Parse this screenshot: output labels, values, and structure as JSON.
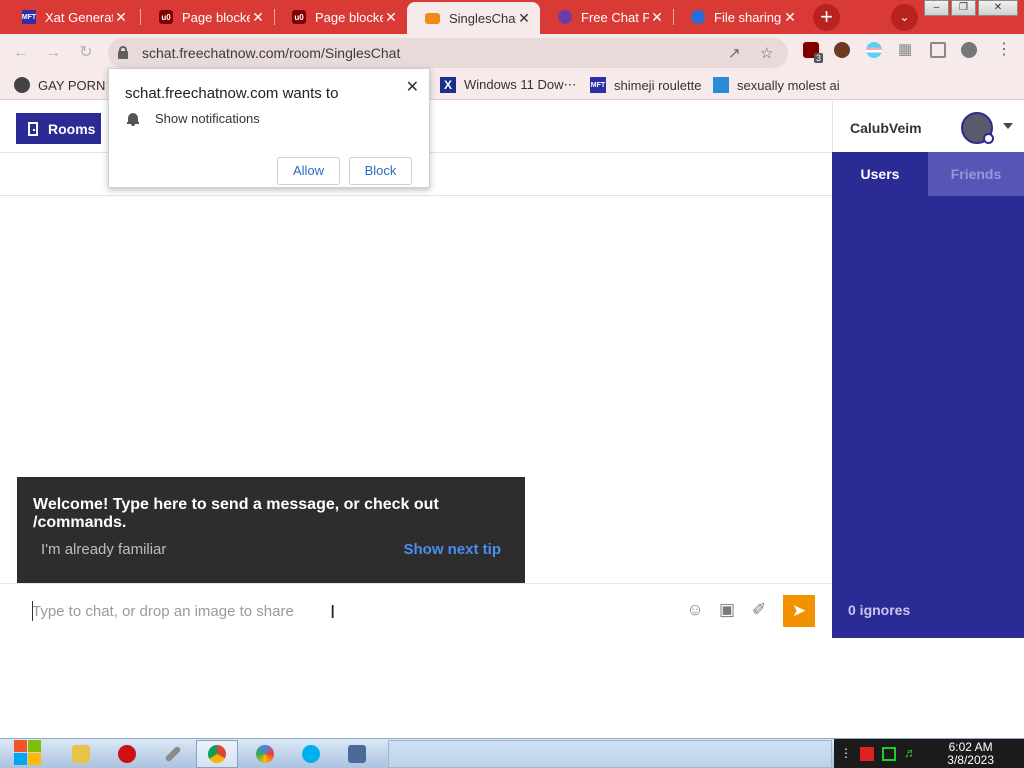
{
  "browser": {
    "tabs": [
      {
        "title": "Xat Generat",
        "favicon": "mft-icon"
      },
      {
        "title": "Page blocke",
        "favicon": "ublock-icon"
      },
      {
        "title": "Page blocke",
        "favicon": "ublock-icon"
      },
      {
        "title": "SinglesChat",
        "favicon": "chat-bubble-icon"
      },
      {
        "title": "Free Chat P",
        "favicon": "freechat-icon"
      },
      {
        "title": "File sharing",
        "favicon": "share-icon"
      }
    ],
    "close_glyph": "✕",
    "new_tab_glyph": "+",
    "tab_search_glyph": "⌄",
    "url": "schat.freechatnow.com/room/SinglesChat",
    "extension_badge": "3",
    "bookmarks": [
      {
        "label": "GAY PORN X",
        "icon": "gp-icon"
      },
      {
        "label": "Windows 11 Dow⋯",
        "icon": "windows-x-icon"
      },
      {
        "label": "shimeji roulette",
        "icon": "mft-icon"
      },
      {
        "label": "sexually molest ai",
        "icon": "ai-icon"
      }
    ],
    "accent_color": "#d93a36"
  },
  "notification": {
    "title": "schat.freechatnow.com wants to",
    "permission": "Show notifications",
    "allow_label": "Allow",
    "block_label": "Block",
    "close_glyph": "✕"
  },
  "app": {
    "rooms_label": "Rooms",
    "username": "CalubVeim",
    "sidebar_tabs": {
      "users": "Users",
      "friends": "Friends"
    },
    "ignores": "0 ignores",
    "tip": {
      "message": "Welcome! Type here to send a message, or check out /commands.",
      "familiar": "I'm already familiar",
      "next": "Show next tip"
    },
    "input_placeholder": "Type to chat, or drop an image to share",
    "brand_color": "#2b2b95",
    "send_color": "#f39200"
  },
  "taskbar": {
    "time": "6:02 AM",
    "date": "3/8/2023"
  }
}
